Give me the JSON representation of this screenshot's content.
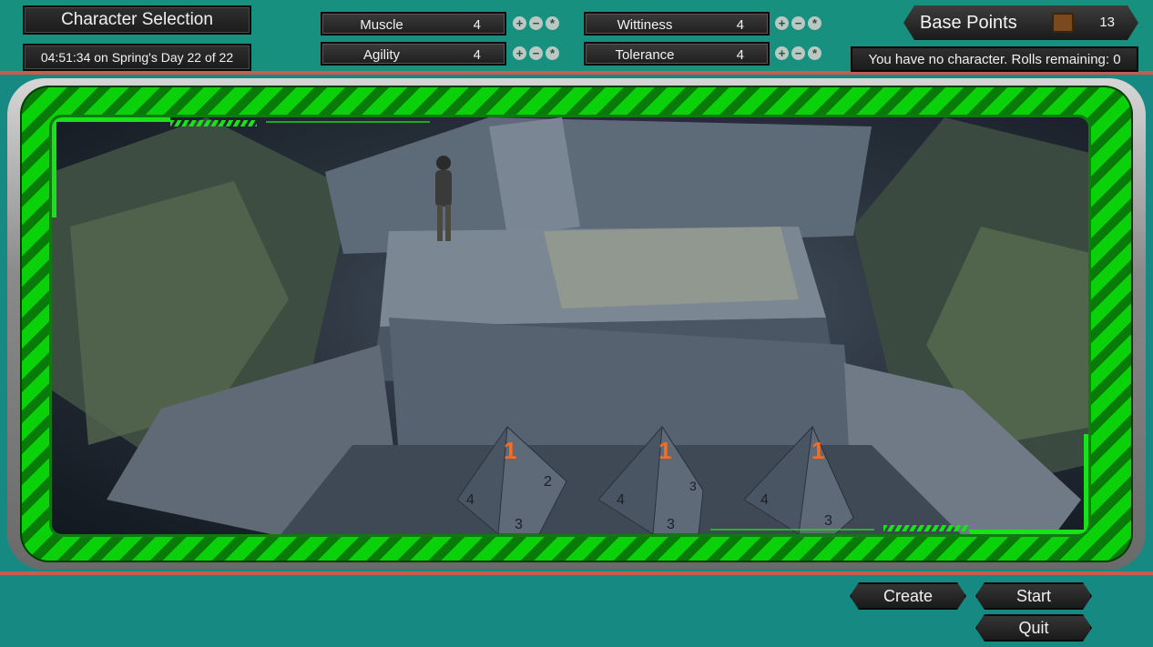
{
  "header": {
    "title": "Character Selection",
    "datetime": "04:51:34 on Spring's Day 22 of 22"
  },
  "stats": [
    {
      "name": "Muscle",
      "value": "4"
    },
    {
      "name": "Agility",
      "value": "4"
    },
    {
      "name": "Wittiness",
      "value": "4"
    },
    {
      "name": "Tolerance",
      "value": "4"
    }
  ],
  "stat_buttons": {
    "plus": "+",
    "minus": "−",
    "random": "*"
  },
  "base_points": {
    "label": "Base Points",
    "value": "13",
    "icon": "scroll-icon"
  },
  "status_text": "You have no character. Rolls remaining: 0",
  "dice_faces": [
    "1",
    "4",
    "2",
    "3",
    "1",
    "4",
    "3",
    "3",
    "1",
    "4",
    "3"
  ],
  "buttons": {
    "create": "Create",
    "start": "Start",
    "quit": "Quit"
  },
  "colors": {
    "background": "#168a82",
    "frame_green": "#0bd10b",
    "accent_line": "#c85c4e",
    "dice_number": "#ff6a1a"
  }
}
